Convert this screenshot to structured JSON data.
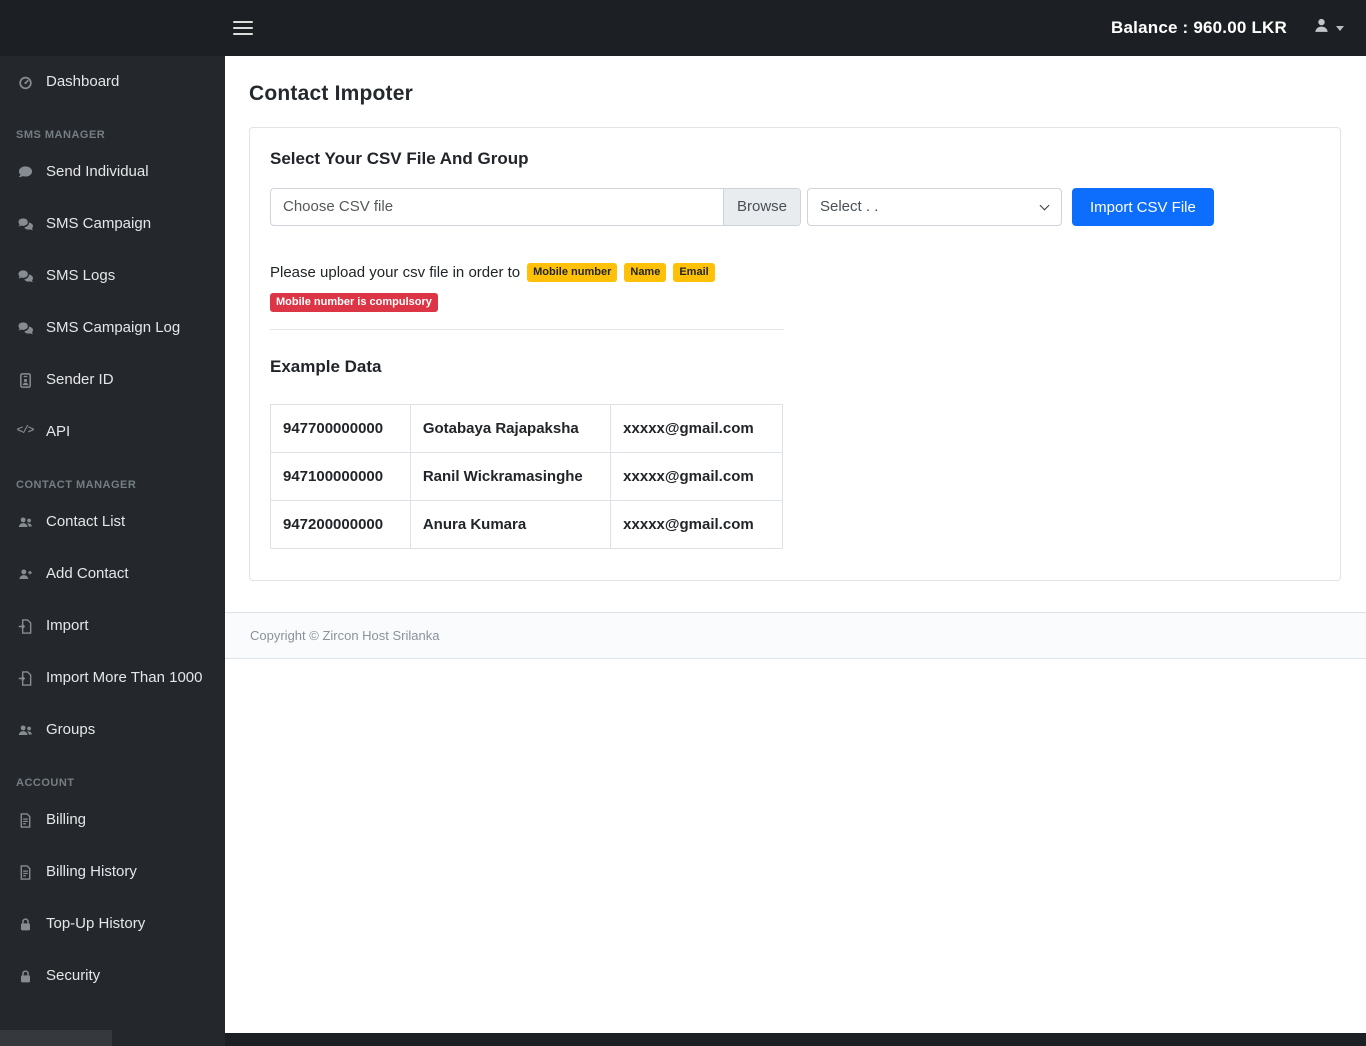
{
  "colors": {
    "accent": "#0d6efd",
    "warning": "#ffc107",
    "danger": "#dc3545",
    "topbar_bg": "#1c2024",
    "sidebar_bg": "#24282c"
  },
  "topbar": {
    "balance": "Balance : 960.00 LKR",
    "menu_icon": "hamburger-icon",
    "user_icon": "user-icon",
    "caret_icon": "caret-down-icon"
  },
  "sidebar": {
    "items": [
      {
        "type": "item",
        "label": "Dashboard",
        "icon": "dashboard-icon"
      },
      {
        "type": "header",
        "label": "SMS MANAGER"
      },
      {
        "type": "item",
        "label": "Send Individual",
        "icon": "comment-icon"
      },
      {
        "type": "item",
        "label": "SMS Campaign",
        "icon": "comments-icon"
      },
      {
        "type": "item",
        "label": "SMS Logs",
        "icon": "comments-icon"
      },
      {
        "type": "item",
        "label": "SMS Campaign Log",
        "icon": "comments-icon"
      },
      {
        "type": "item",
        "label": "Sender ID",
        "icon": "id-badge-icon"
      },
      {
        "type": "item",
        "label": "API",
        "icon": "code-icon"
      },
      {
        "type": "header",
        "label": "CONTACT MANAGER"
      },
      {
        "type": "item",
        "label": "Contact List",
        "icon": "users-icon"
      },
      {
        "type": "item",
        "label": "Add Contact",
        "icon": "user-plus-icon"
      },
      {
        "type": "item",
        "label": "Import",
        "icon": "file-import-icon"
      },
      {
        "type": "item",
        "label": "Import More Than 1000",
        "icon": "file-import-icon"
      },
      {
        "type": "item",
        "label": "Groups",
        "icon": "users-icon"
      },
      {
        "type": "header",
        "label": "ACCOUNT"
      },
      {
        "type": "item",
        "label": "Billing",
        "icon": "invoice-icon"
      },
      {
        "type": "item",
        "label": "Billing History",
        "icon": "invoice-icon"
      },
      {
        "type": "item",
        "label": "Top-Up History",
        "icon": "lock-icon"
      },
      {
        "type": "item",
        "label": "Security",
        "icon": "lock-icon"
      }
    ]
  },
  "main": {
    "page_title": "Contact Impoter",
    "card": {
      "heading": "Select Your CSV File And Group",
      "file_input": {
        "value": "Choose CSV file",
        "browse_label": "Browse"
      },
      "group_select": {
        "value": "Select . ."
      },
      "import_button": "Import CSV File",
      "note": {
        "text": "Please upload your csv file in order to",
        "badges": [
          "Mobile number",
          "Name",
          "Email"
        ],
        "warning": "Mobile number is compulsory"
      },
      "example": {
        "heading": "Example Data",
        "table": {
          "rows": [
            [
              "947700000000",
              "Gotabaya Rajapaksha",
              "xxxxx@gmail.com"
            ],
            [
              "947100000000",
              "Ranil Wickramasinghe",
              "xxxxx@gmail.com"
            ],
            [
              "947200000000",
              "Anura Kumara",
              "xxxxx@gmail.com"
            ]
          ]
        }
      }
    }
  },
  "footer": {
    "copyright": "Copyright © Zircon Host Srilanka"
  }
}
